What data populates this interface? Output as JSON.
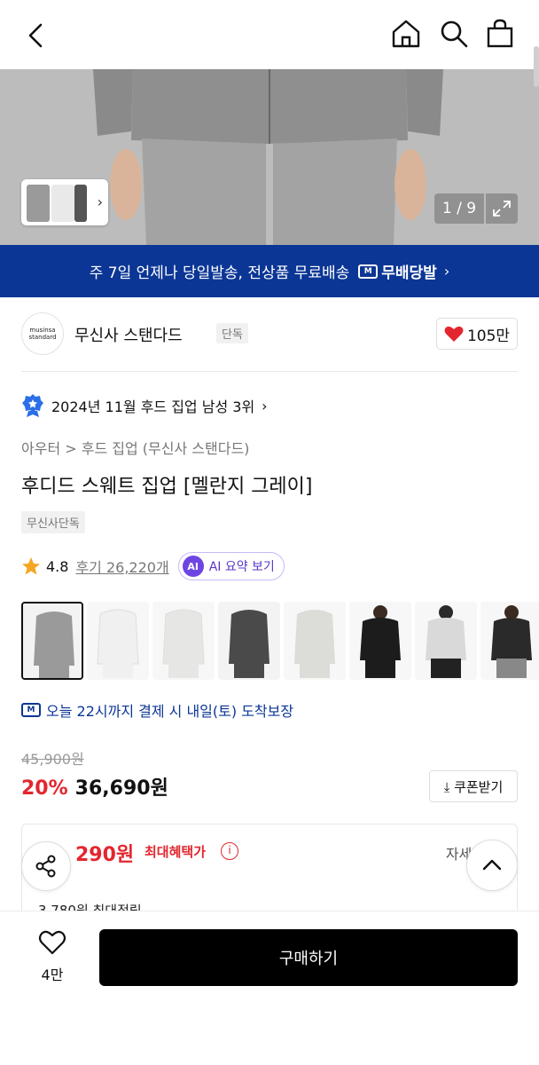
{
  "topbar": {
    "back_icon": "chevron-left-icon",
    "home_icon": "home-icon",
    "search_icon": "search-icon",
    "bag_icon": "shopping-bag-icon"
  },
  "gallery": {
    "counter": "1 / 9",
    "expand_icon": "expand-icon"
  },
  "promo": {
    "text": "주 7일 언제나 당일발송, 전상품 무료배송",
    "badge_icon_text": "M",
    "badge_label": "무배당발",
    "arrow": "›"
  },
  "brand": {
    "logo_line1": "musinsa",
    "logo_line2": "standard",
    "name": "무신사 스탠다드",
    "tag": "단독",
    "likes": "105만"
  },
  "ranking": {
    "text": "2024년 11월 후드 집업 남성 3위",
    "arrow": "›"
  },
  "breadcrumb": "아우터 > 후드 집업 (무신사 스탠다드)",
  "product": {
    "title": "후디드 스웨트 집업 [멜란지 그레이]",
    "exclusive_tag": "무신사단독",
    "rating": "4.8",
    "reviews": "후기 26,220개",
    "ai_icon_text": "AI",
    "ai_summary": "AI 요약 보기"
  },
  "swatch_colors": [
    "#9a9a9a",
    "#f0f0f0",
    "#e6e6e4",
    "#4a4a4a",
    "#dcdcd8",
    "#1c1c1c",
    "#d9d9d9",
    "#2a2a2a"
  ],
  "delivery": {
    "icon_text": "M",
    "text": "오늘 22시까지 결제 시 내일(토) 도착보장"
  },
  "price": {
    "original": "45,900원",
    "discount": "20%",
    "sale": "36,690원",
    "coupon_label": "⤓ 쿠폰받기"
  },
  "benefit": {
    "amount": "290원",
    "label": "최대혜택가",
    "info_icon_text": "i",
    "detail": "자세히",
    "points": "3,780원 최대적립"
  },
  "bottom": {
    "wish_count": "4만",
    "buy_label": "구매하기"
  },
  "colors": {
    "brand_blue": "#0b3695",
    "sale_red": "#e3262e",
    "ai_purple": "#6e45e2"
  }
}
